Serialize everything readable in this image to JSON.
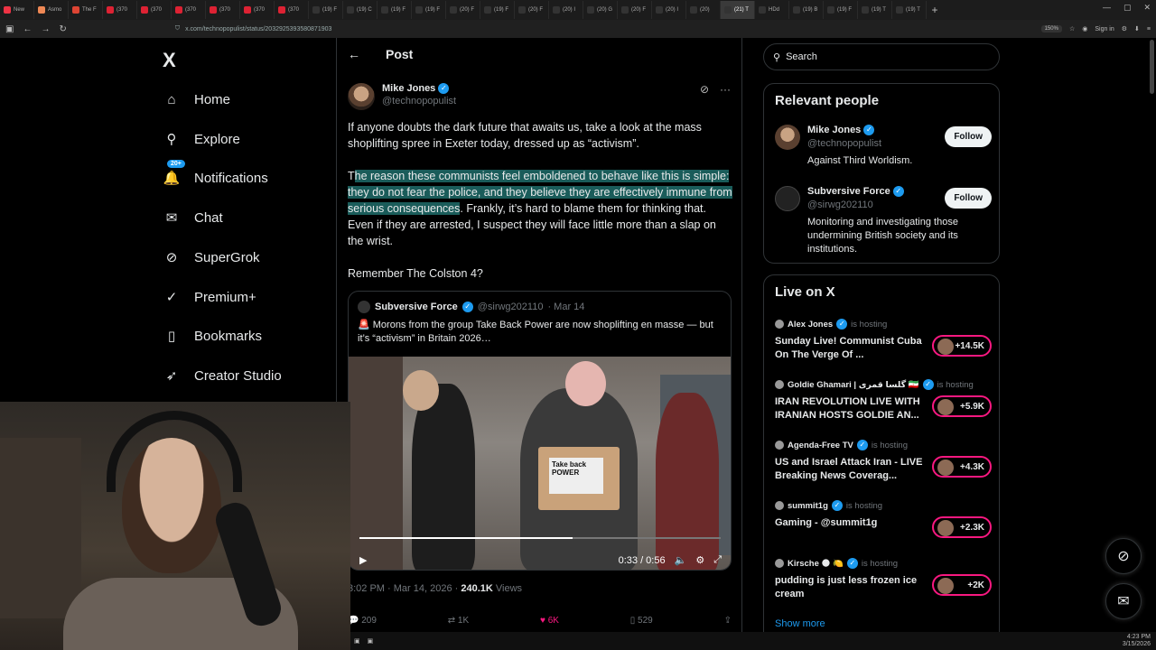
{
  "browser": {
    "tabs": [
      {
        "label": "New",
        "color": "#e34"
      },
      {
        "label": "Asmo",
        "color": "#e85"
      },
      {
        "label": "The F",
        "color": "#d43"
      },
      {
        "label": "(370",
        "color": "#d23"
      },
      {
        "label": "(370",
        "color": "#d23"
      },
      {
        "label": "(370",
        "color": "#d23"
      },
      {
        "label": "(370",
        "color": "#d23"
      },
      {
        "label": "(370",
        "color": "#d23"
      },
      {
        "label": "(370",
        "color": "#d23"
      },
      {
        "label": "(19) F",
        "color": "#333"
      },
      {
        "label": "(19) C",
        "color": "#333"
      },
      {
        "label": "(19) F",
        "color": "#333"
      },
      {
        "label": "(19) F",
        "color": "#333"
      },
      {
        "label": "(20) F",
        "color": "#333"
      },
      {
        "label": "(19) F",
        "color": "#333"
      },
      {
        "label": "(20) F",
        "color": "#333"
      },
      {
        "label": "(20) I",
        "color": "#333"
      },
      {
        "label": "(20) G",
        "color": "#333"
      },
      {
        "label": "(20) F",
        "color": "#333"
      },
      {
        "label": "(20) I",
        "color": "#333"
      },
      {
        "label": "(20)",
        "color": "#333"
      },
      {
        "label": "(21) T",
        "color": "#333"
      },
      {
        "label": "HDd",
        "color": "#333"
      },
      {
        "label": "(19) B",
        "color": "#333"
      },
      {
        "label": "(19) F",
        "color": "#333"
      },
      {
        "label": "(19) T",
        "color": "#333"
      },
      {
        "label": "(19) T",
        "color": "#333"
      }
    ],
    "url": "x.com/technopopulist/status/2032925393580871903",
    "zoom": "150%",
    "signin": "Sign in"
  },
  "leftnav": {
    "logo": "X",
    "items": [
      {
        "label": "Home",
        "icon": "home-icon",
        "glyph": "⌂"
      },
      {
        "label": "Explore",
        "icon": "search-icon",
        "glyph": "⚲"
      },
      {
        "label": "Notifications",
        "icon": "bell-icon",
        "glyph": "🔔",
        "badge": "20+"
      },
      {
        "label": "Chat",
        "icon": "mail-icon",
        "glyph": "✉"
      },
      {
        "label": "SuperGrok",
        "icon": "grok-icon",
        "glyph": "⊘"
      },
      {
        "label": "Premium+",
        "icon": "premium-icon",
        "glyph": "✓"
      },
      {
        "label": "Bookmarks",
        "icon": "bookmark-icon",
        "glyph": "▯"
      },
      {
        "label": "Creator Studio",
        "icon": "rocket-icon",
        "glyph": "➶"
      }
    ]
  },
  "post": {
    "header": "Post",
    "author_name": "Mike Jones",
    "author_handle": "@technopopulist",
    "para1": "If anyone doubts the dark future that awaits us, take a look at the mass shoplifting spree in Exeter today, dressed up as “activism”.",
    "para2_start": "T",
    "para2_highlight": "he reason these communists feel emboldened to behave like this is simple: they do not fear the police, and they believe they are effectively immune from serious consequences",
    "para2_end": ". Frankly, it’s hard to blame them for thinking that. Even if they are arrested, I suspect they will face little more than a slap on the wrist.",
    "para3": "Remember The Colston 4?",
    "quote": {
      "name": "Subversive Force",
      "handle": "@sirwg202110",
      "date": "· Mar 14",
      "text": "🚨 Morons from the group Take Back Power are now shoplifting en masse — but it’s “activism” in Britain 2026…",
      "box_label": "Take back POWER",
      "time": "0:33 / 0:56",
      "progress": 0.59
    },
    "timestamp": "3:02 PM · Mar 14, 2026 · ",
    "views_count": "240.1K",
    "views_label": " Views",
    "actions": {
      "replies": "209",
      "reposts": "1K",
      "likes": "6K",
      "bookmarks": "529"
    }
  },
  "right": {
    "search_placeholder": "Search",
    "relevant_title": "Relevant people",
    "people": [
      {
        "name": "Mike Jones",
        "handle": "@technopopulist",
        "bio": "Against Third Worldism.",
        "follow": "Follow"
      },
      {
        "name": "Subversive Force",
        "handle": "@sirwg202110",
        "bio": "Monitoring and investigating those undermining British society and its institutions.",
        "follow": "Follow"
      }
    ],
    "live_title": "Live on X",
    "live": [
      {
        "host": "Alex Jones",
        "status": "is hosting",
        "title": "Sunday Live! Communist Cuba On The Verge Of ...",
        "count": "+14.5K"
      },
      {
        "host": "Goldie Ghamari | گلسا قمری 🇮🇷",
        "status": "is hosting",
        "title": "IRAN REVOLUTION LIVE WITH IRANIAN HOSTS GOLDIE AN...",
        "count": "+5.9K"
      },
      {
        "host": "Agenda-Free TV",
        "status": "is hosting",
        "title": "US and Israel Attack Iran - LIVE Breaking News Coverag...",
        "count": "+4.3K"
      },
      {
        "host": "summit1g",
        "status": "is hosting",
        "title": "Gaming - @summit1g",
        "count": "+2.3K"
      },
      {
        "host": "Kirsche 🌑 🍋",
        "status": "is hosting",
        "title": "pudding is just less frozen ice cream",
        "count": "+2K"
      }
    ],
    "show_more": "Show more"
  },
  "taskbar": {
    "time": "4:23 PM",
    "date": "3/15/2026"
  }
}
